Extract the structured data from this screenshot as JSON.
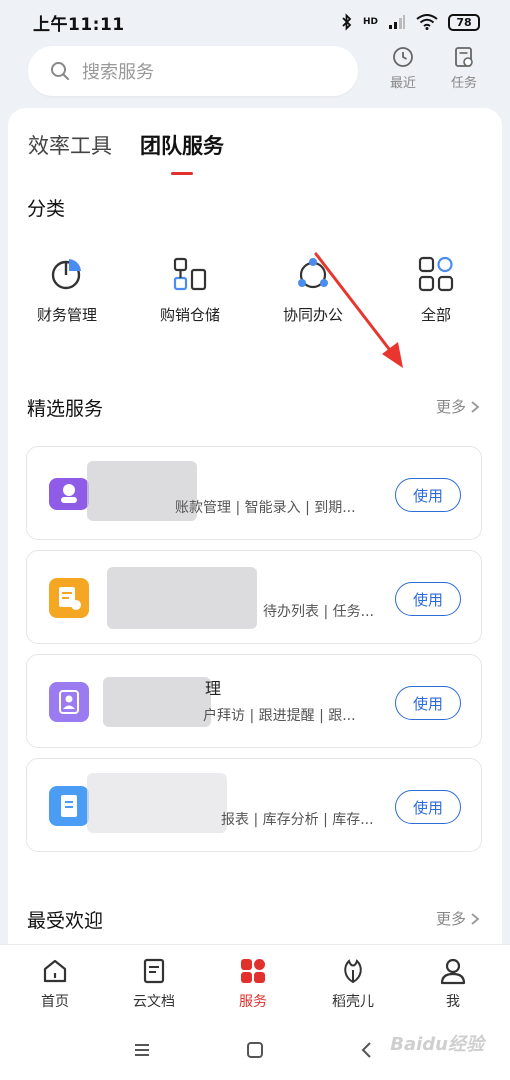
{
  "status_bar": {
    "time": "上午11:11",
    "battery": "78",
    "net_label": "HD"
  },
  "header": {
    "search_placeholder": "搜索服务",
    "recent_label": "最近",
    "task_label": "任务"
  },
  "tabs": [
    {
      "label": "效率工具",
      "active": false
    },
    {
      "label": "团队服务",
      "active": true
    }
  ],
  "categories": {
    "title": "分类",
    "items": [
      {
        "label": "财务管理",
        "icon": "pie-chart-icon"
      },
      {
        "label": "购销仓储",
        "icon": "warehouse-flow-icon"
      },
      {
        "label": "协同办公",
        "icon": "collaboration-icon"
      },
      {
        "label": "全部",
        "icon": "grid-all-icon"
      }
    ]
  },
  "featured": {
    "title": "精选服务",
    "more_label": "更多",
    "items": [
      {
        "title": "",
        "desc": "账款管理 | 智能录入 | 到期...",
        "button": "使用",
        "icon": "finance-app-icon",
        "color": "#8e5ce6"
      },
      {
        "title": "",
        "desc": "待办列表 | 任务...",
        "button": "使用",
        "icon": "task-app-icon",
        "color": "#f5a623"
      },
      {
        "title": "理",
        "desc": "户拜访 | 跟进提醒 | 跟...",
        "button": "使用",
        "icon": "contact-app-icon",
        "color": "#9a7cf0"
      },
      {
        "title": "",
        "desc": "报表 | 库存分析 | 库存...",
        "button": "使用",
        "icon": "inventory-app-icon",
        "color": "#4a9cf5"
      }
    ]
  },
  "popular": {
    "title": "最受欢迎",
    "more_label": "更多"
  },
  "bottom_nav": [
    {
      "label": "首页",
      "icon": "home-icon",
      "active": false
    },
    {
      "label": "云文档",
      "icon": "document-icon",
      "active": false
    },
    {
      "label": "服务",
      "icon": "services-grid-icon",
      "active": true
    },
    {
      "label": "稻壳儿",
      "icon": "leaf-icon",
      "active": false
    },
    {
      "label": "我",
      "icon": "person-icon",
      "active": false
    }
  ],
  "watermark": "Baidu经验",
  "colors": {
    "accent": "#e2312d",
    "button_blue": "#2d6bd7"
  }
}
